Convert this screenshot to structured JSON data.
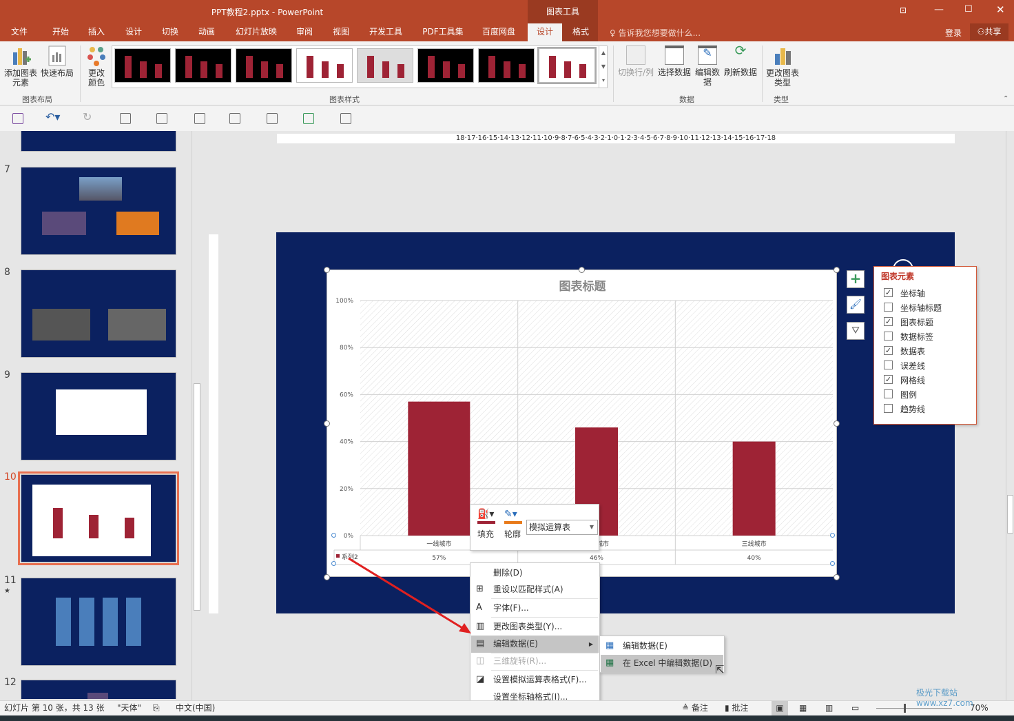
{
  "window": {
    "title": "PPT教程2.pptx - PowerPoint",
    "context_group": "图表工具",
    "login": "登录",
    "share": "共享",
    "tell_me": "告诉我您想要做什么..."
  },
  "tabs": [
    {
      "label": "文件"
    },
    {
      "label": "开始"
    },
    {
      "label": "插入"
    },
    {
      "label": "设计"
    },
    {
      "label": "切换"
    },
    {
      "label": "动画"
    },
    {
      "label": "幻灯片放映"
    },
    {
      "label": "审阅"
    },
    {
      "label": "视图"
    },
    {
      "label": "开发工具"
    },
    {
      "label": "PDF工具集"
    },
    {
      "label": "百度网盘"
    },
    {
      "label": "设计",
      "active": true
    },
    {
      "label": "格式"
    }
  ],
  "ribbon": {
    "add_element": "添加图表元素",
    "quick_layout": "快速布局",
    "group_layout": "图表布局",
    "change_colors": "更改颜色",
    "group_styles": "图表样式",
    "switch_row_col": "切换行/列",
    "select_data": "选择数据",
    "edit_data": "编辑数据",
    "refresh_data": "刷新数据",
    "group_data": "数据",
    "change_type": "更改图表类型",
    "group_type": "类型"
  },
  "slides": [
    {
      "number": "7"
    },
    {
      "number": "8"
    },
    {
      "number": "9"
    },
    {
      "number": "10",
      "selected": true
    },
    {
      "number": "11",
      "star": "★"
    },
    {
      "number": "12"
    }
  ],
  "ruler": {
    "h": "18·17·16·15·14·13·12·11·10·9·8·7·6·5·4·3·2·1·0·1·2·3·4·5·6·7·8·9·10·11·12·13·14·15·16·17·18"
  },
  "chart_data": {
    "type": "bar",
    "title": "图表标题",
    "categories": [
      "一线城市",
      "二线城市",
      "三线城市"
    ],
    "series": [
      {
        "name": "系列2",
        "values": [
          57,
          46,
          40
        ]
      }
    ],
    "value_labels": [
      "57%",
      "46%",
      "40%"
    ],
    "yticks": [
      "0%",
      "20%",
      "40%",
      "60%",
      "80%",
      "100%"
    ],
    "ylim": [
      0,
      100
    ],
    "grid": true,
    "data_table": true,
    "bar_color": "#9e2335"
  },
  "chart_elements": {
    "title": "图表元素",
    "items": [
      {
        "label": "坐标轴",
        "checked": true
      },
      {
        "label": "坐标轴标题",
        "checked": false
      },
      {
        "label": "图表标题",
        "checked": true
      },
      {
        "label": "数据标签",
        "checked": false
      },
      {
        "label": "数据表",
        "checked": true
      },
      {
        "label": "误差线",
        "checked": false
      },
      {
        "label": "网格线",
        "checked": true
      },
      {
        "label": "图例",
        "checked": false
      },
      {
        "label": "趋势线",
        "checked": false
      }
    ]
  },
  "mini_toolbar": {
    "fill": "填充",
    "outline": "轮廓",
    "dropdown": "模拟运算表"
  },
  "context_menu": [
    {
      "label": "删除(D)"
    },
    {
      "label": "重设以匹配样式(A)"
    },
    {
      "label": "字体(F)..."
    },
    {
      "label": "更改图表类型(Y)..."
    },
    {
      "label": "编辑数据(E)",
      "highlight": true
    },
    {
      "label": "三维旋转(R)...",
      "disabled": true
    },
    {
      "label": "设置模拟运算表格式(F)..."
    },
    {
      "label": "设置坐标轴格式(I)..."
    }
  ],
  "submenu": [
    {
      "label": "编辑数据(E)"
    },
    {
      "label": "在 Excel 中编辑数据(D)",
      "highlight": true
    }
  ],
  "status": {
    "slide_info": "幻灯片 第 10 张，共 13 张",
    "theme": "\"天体\"",
    "language": "中文(中国)",
    "notes": "备注",
    "comments": "批注",
    "zoom": "70%"
  },
  "watermark": "极光下载站 www.xz7.com"
}
